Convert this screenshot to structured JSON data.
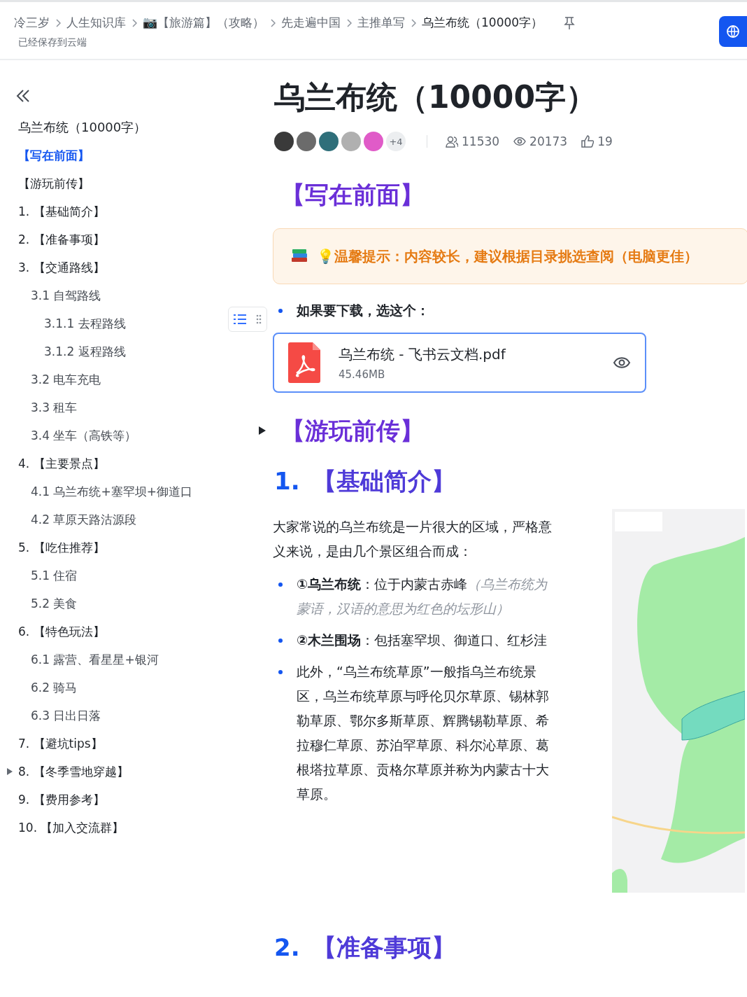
{
  "header": {
    "breadcrumbs": [
      {
        "label": "冷三岁"
      },
      {
        "label": "人生知识库"
      },
      {
        "label": "📷【旅游篇】（攻略）"
      },
      {
        "label": "先走遍中国"
      },
      {
        "label": "主推单写"
      },
      {
        "label": "乌兰布统（10000字）"
      }
    ],
    "save_status": "已经保存到云端"
  },
  "toc": {
    "title": "乌兰布统（10000字）",
    "items": [
      {
        "label": "【写在前面】",
        "selected": true
      },
      {
        "label": "【游玩前传】",
        "selected": false
      },
      {
        "label": "1. 【基础简介】",
        "selected": false
      },
      {
        "label": "2. 【准备事项】",
        "selected": false
      },
      {
        "label": "3. 【交通路线】",
        "selected": false,
        "children": [
          {
            "label": "3.1 自驾路线",
            "selected": false,
            "children": [
              {
                "label": "3.1.1 去程路线",
                "selected": false
              },
              {
                "label": "3.1.2 返程路线",
                "selected": false
              }
            ]
          },
          {
            "label": "3.2 电车充电",
            "selected": false
          },
          {
            "label": "3.3 租车",
            "selected": false
          },
          {
            "label": "3.4 坐车（高铁等）",
            "selected": false
          }
        ]
      },
      {
        "label": "4. 【主要景点】",
        "selected": false,
        "children": [
          {
            "label": "4.1 乌兰布统+塞罕坝+御道口",
            "selected": false
          },
          {
            "label": "4.2 草原天路沽源段",
            "selected": false
          }
        ]
      },
      {
        "label": "5. 【吃住推荐】",
        "selected": false,
        "children": [
          {
            "label": "5.1 住宿",
            "selected": false
          },
          {
            "label": "5.2 美食",
            "selected": false
          }
        ]
      },
      {
        "label": "6. 【特色玩法】",
        "selected": false,
        "children": [
          {
            "label": "6.1 露营、看星星+银河",
            "selected": false
          },
          {
            "label": "6.2 骑马",
            "selected": false
          },
          {
            "label": "6.3 日出日落",
            "selected": false
          }
        ]
      },
      {
        "label": "7. 【避坑tips】",
        "selected": false
      },
      {
        "label": "8. 【冬季雪地穿越】",
        "selected": false,
        "expanded": false
      },
      {
        "label": "9. 【费用参考】",
        "selected": false
      },
      {
        "label": "10. 【加入交流群】",
        "selected": false
      }
    ]
  },
  "doc": {
    "title": "乌兰布统（10000字）",
    "collaborators": [
      {
        "kind": "avatar",
        "color": "#3a3a3a"
      },
      {
        "kind": "avatar",
        "color": "#6b6b6b"
      },
      {
        "kind": "avatar",
        "color": "#2f6f7a"
      },
      {
        "kind": "avatar",
        "color": "#b0b0b0"
      },
      {
        "kind": "avatar",
        "color": "#e05bc8"
      },
      {
        "kind": "more",
        "label": "+4"
      }
    ],
    "stats": {
      "readers": "11530",
      "views": "20173",
      "likes": "19"
    },
    "blocks": [
      {
        "kind": "heading",
        "text": "【写在前面】"
      },
      {
        "kind": "callout",
        "text": "💡温馨提示：内容较长，建议根据目录挑选查阅（电脑更佳）"
      },
      {
        "kind": "bullet",
        "lead": "如果要下载，选这个："
      },
      {
        "kind": "file",
        "name": "乌兰布统 - 飞书云文档.pdf",
        "size": "45.46MB"
      },
      {
        "kind": "heading",
        "text": "【游玩前传】",
        "expanded": false
      },
      {
        "kind": "numbered",
        "number": "1.",
        "text": "【基础简介】"
      },
      {
        "kind": "paragraph",
        "text": "大家常说的乌兰布统是一片很大的区域，严格意义来说，是由几个景区组合而成："
      },
      {
        "kind": "bullet",
        "lead": "①乌兰布统",
        "text": "：位于内蒙古赤峰",
        "note": "（乌兰布统为蒙语，汉语的意思为红色的坛形山）"
      },
      {
        "kind": "bullet",
        "lead": "②木兰围场",
        "text": "：包括塞罕坝、御道口、红杉洼"
      },
      {
        "kind": "bullet",
        "text": "此外，“乌兰布统草原”一般指乌兰布统景区，乌兰布统草原与呼伦贝尔草原、锡林郭勒草原、鄂尔多斯草原、辉腾锡勒草原、希拉穆仁草原、苏泊罕草原、科尔沁草原、葛根塔拉草原、贡格尔草原并称为内蒙古十大草原。"
      },
      {
        "kind": "numbered",
        "number": "2.",
        "text": "【准备事项】"
      }
    ]
  }
}
